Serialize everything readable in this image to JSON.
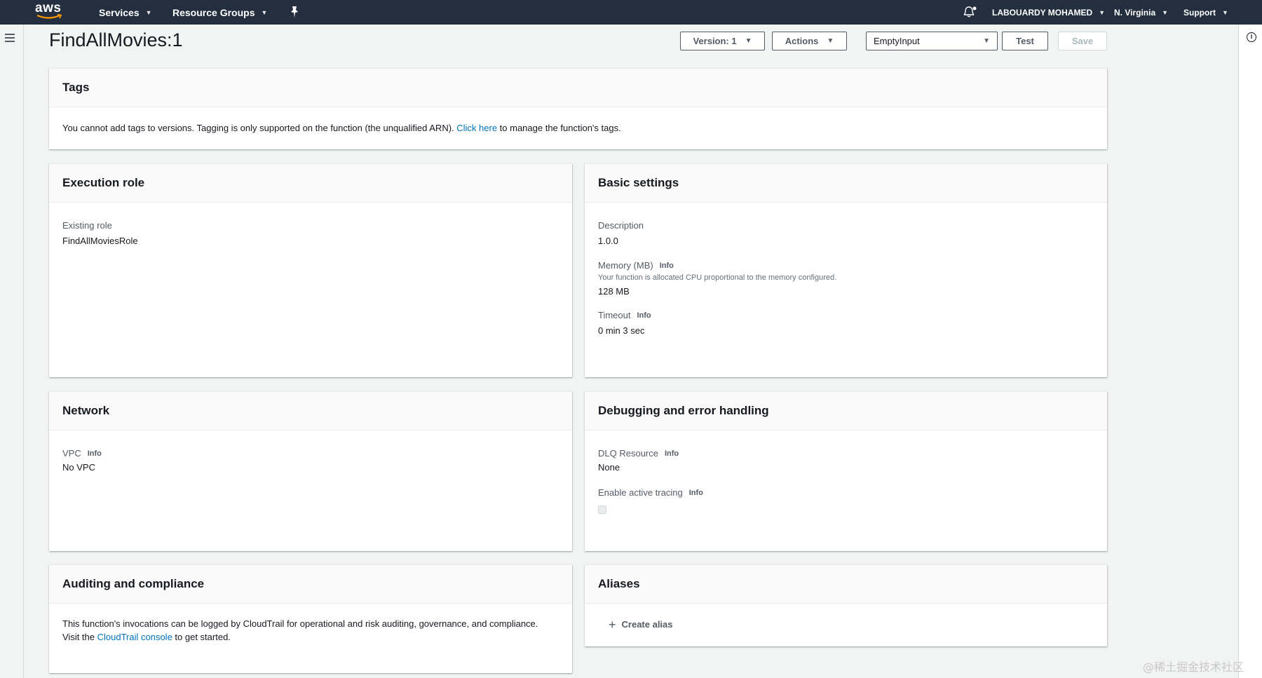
{
  "nav": {
    "logo_text": "aws",
    "services": "Services",
    "resource_groups": "Resource Groups",
    "user": "LABOUARDY MOHAMED",
    "region": "N. Virginia",
    "support": "Support"
  },
  "header": {
    "title": "FindAllMovies:1",
    "version_label": "Version: 1",
    "actions_label": "Actions",
    "test_event": "EmptyInput",
    "test_label": "Test",
    "save_label": "Save"
  },
  "tags": {
    "title": "Tags",
    "text_before": "You cannot add tags to versions. Tagging is only supported on the function (the unqualified ARN). ",
    "link": "Click here",
    "text_after": " to manage the function's tags."
  },
  "execution_role": {
    "title": "Execution role",
    "label": "Existing role",
    "value": "FindAllMoviesRole"
  },
  "basic_settings": {
    "title": "Basic settings",
    "description_label": "Description",
    "description_value": "1.0.0",
    "memory_label": "Memory (MB)",
    "memory_info": "Info",
    "memory_desc": "Your function is allocated CPU proportional to the memory configured.",
    "memory_value": "128 MB",
    "timeout_label": "Timeout",
    "timeout_info": "Info",
    "timeout_value": "0 min 3 sec"
  },
  "network": {
    "title": "Network",
    "vpc_label": "VPC",
    "vpc_info": "Info",
    "vpc_value": "No VPC"
  },
  "debugging": {
    "title": "Debugging and error handling",
    "dlq_label": "DLQ Resource",
    "dlq_info": "Info",
    "dlq_value": "None",
    "tracing_label": "Enable active tracing",
    "tracing_info": "Info",
    "tracing_checked": false
  },
  "auditing": {
    "title": "Auditing and compliance",
    "line1": "This function's invocations can be logged by CloudTrail for operational and risk auditing, governance, and compliance.",
    "line2_before": "Visit the ",
    "link": "CloudTrail console",
    "line2_after": " to get started."
  },
  "aliases": {
    "title": "Aliases",
    "create_label": "Create alias"
  },
  "watermark": "@稀土掘金技术社区",
  "colors": {
    "topnav": "#232f3e",
    "link": "#0073bb",
    "background": "#f2f3f3"
  }
}
